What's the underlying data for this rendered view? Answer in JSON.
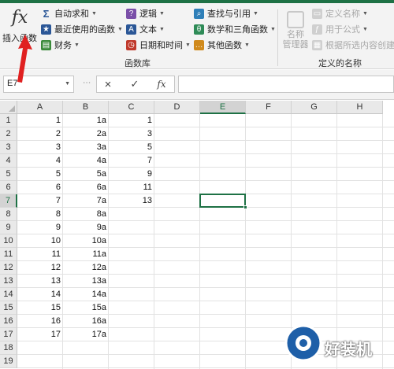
{
  "ribbon": {
    "insert_function": {
      "icon": "fx",
      "label": "插入函数"
    },
    "library": {
      "autosum": "自动求和",
      "recent": "最近使用的函数",
      "financial": "财务",
      "logical": "逻辑",
      "text": "文本",
      "datetime": "日期和时间",
      "lookup": "查找与引用",
      "math": "数学和三角函数",
      "other": "其他函数",
      "group_label": "函数库"
    },
    "defined_names": {
      "name_manager_line1": "名称",
      "name_manager_line2": "管理器",
      "define_name": "定义名称",
      "use_in_formula": "用于公式",
      "create_from_selection": "根据所选内容创建",
      "group_label": "定义的名称"
    }
  },
  "formula_bar": {
    "name_box": "E7",
    "cancel_icon": "×",
    "enter_icon": "✓",
    "fx_icon": "fx",
    "formula": ""
  },
  "grid": {
    "columns": [
      "A",
      "B",
      "C",
      "D",
      "E",
      "F",
      "G",
      "H"
    ],
    "selected_column": "E",
    "selected_row": 7,
    "rows": [
      {
        "n": "1",
        "a": "1",
        "b": "1a",
        "c": "1"
      },
      {
        "n": "2",
        "a": "2",
        "b": "2a",
        "c": "3"
      },
      {
        "n": "3",
        "a": "3",
        "b": "3a",
        "c": "5"
      },
      {
        "n": "4",
        "a": "4",
        "b": "4a",
        "c": "7"
      },
      {
        "n": "5",
        "a": "5",
        "b": "5a",
        "c": "9"
      },
      {
        "n": "6",
        "a": "6",
        "b": "6a",
        "c": "11"
      },
      {
        "n": "7",
        "a": "7",
        "b": "7a",
        "c": "13"
      },
      {
        "n": "8",
        "a": "8",
        "b": "8a",
        "c": ""
      },
      {
        "n": "9",
        "a": "9",
        "b": "9a",
        "c": ""
      },
      {
        "n": "10",
        "a": "10",
        "b": "10a",
        "c": ""
      },
      {
        "n": "11",
        "a": "11",
        "b": "11a",
        "c": ""
      },
      {
        "n": "12",
        "a": "12",
        "b": "12a",
        "c": ""
      },
      {
        "n": "13",
        "a": "13",
        "b": "13a",
        "c": ""
      },
      {
        "n": "14",
        "a": "14",
        "b": "14a",
        "c": ""
      },
      {
        "n": "15",
        "a": "15",
        "b": "15a",
        "c": ""
      },
      {
        "n": "16",
        "a": "16",
        "b": "16a",
        "c": ""
      },
      {
        "n": "17",
        "a": "17",
        "b": "17a",
        "c": ""
      },
      {
        "n": "18",
        "a": "",
        "b": "",
        "c": ""
      },
      {
        "n": "19",
        "a": "",
        "b": "",
        "c": ""
      }
    ]
  },
  "watermark": {
    "text": "好装机"
  },
  "colors": {
    "accent": "#1e7145",
    "arrow": "#e02020"
  }
}
